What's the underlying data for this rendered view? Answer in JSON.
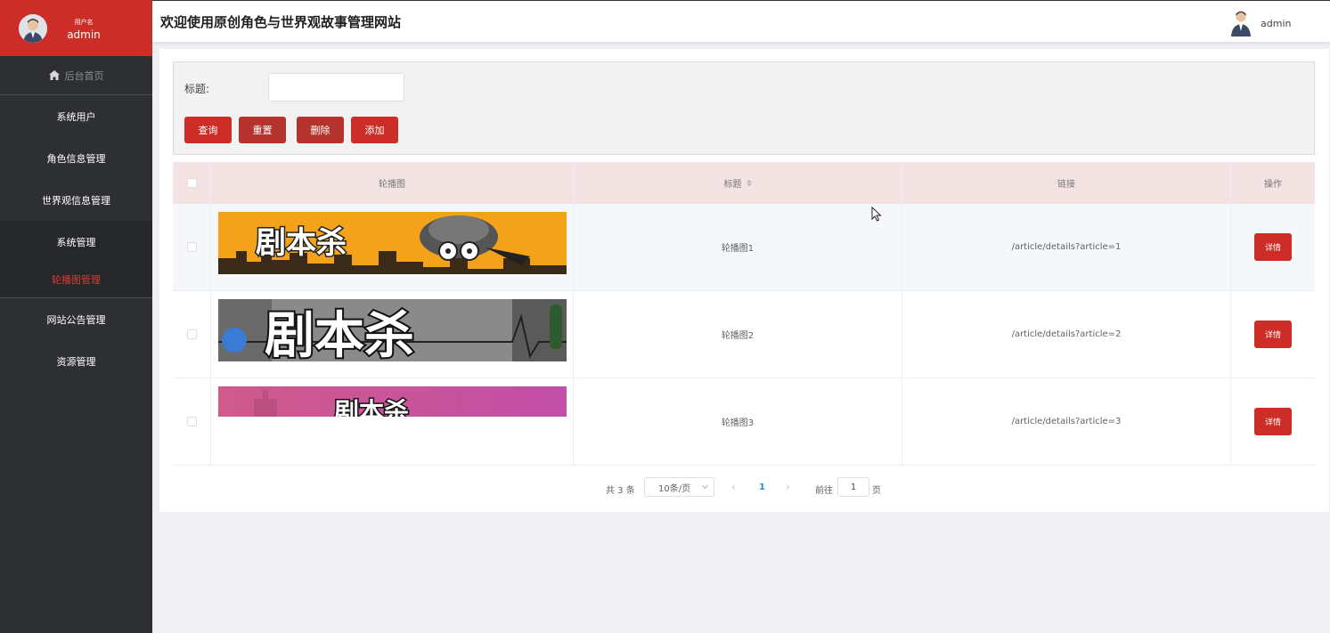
{
  "sidebar": {
    "user_label": "用户名",
    "user_name": "admin",
    "home": "后台首页",
    "items": [
      {
        "label": "系统用户"
      },
      {
        "label": "角色信息管理"
      },
      {
        "label": "世界观信息管理"
      }
    ],
    "group": {
      "label": "系统管理",
      "sub": "轮播图管理"
    },
    "items_after": [
      {
        "label": "网站公告管理"
      },
      {
        "label": "资源管理"
      }
    ]
  },
  "header": {
    "title": "欢迎使用原创角色与世界观故事管理网站",
    "user": "admin"
  },
  "search": {
    "label": "标题:",
    "value": "",
    "buttons": {
      "query": "查询",
      "reset": "重置",
      "delete": "删除",
      "add": "添加"
    }
  },
  "table": {
    "columns": [
      "轮播图",
      "标题",
      "链接",
      "操作"
    ],
    "rows": [
      {
        "title": "轮播图1",
        "link": "/article/details?article=1",
        "action": "详情",
        "banner_text": "剧本杀"
      },
      {
        "title": "轮播图2",
        "link": "/article/details?article=2",
        "action": "详情",
        "banner_text": "剧本杀"
      },
      {
        "title": "轮播图3",
        "link": "/article/details?article=3",
        "action": "详情",
        "banner_text": "剧本杀"
      }
    ]
  },
  "pagination": {
    "total": "共 3 条",
    "page_size": "10条/页",
    "current": "1",
    "goto_label": "前往",
    "goto_value": "1",
    "page_suffix": "页"
  },
  "colors": {
    "brand": "#cc2d27",
    "sidebar": "#2d2f33",
    "header_row": "#f3e3e3"
  }
}
